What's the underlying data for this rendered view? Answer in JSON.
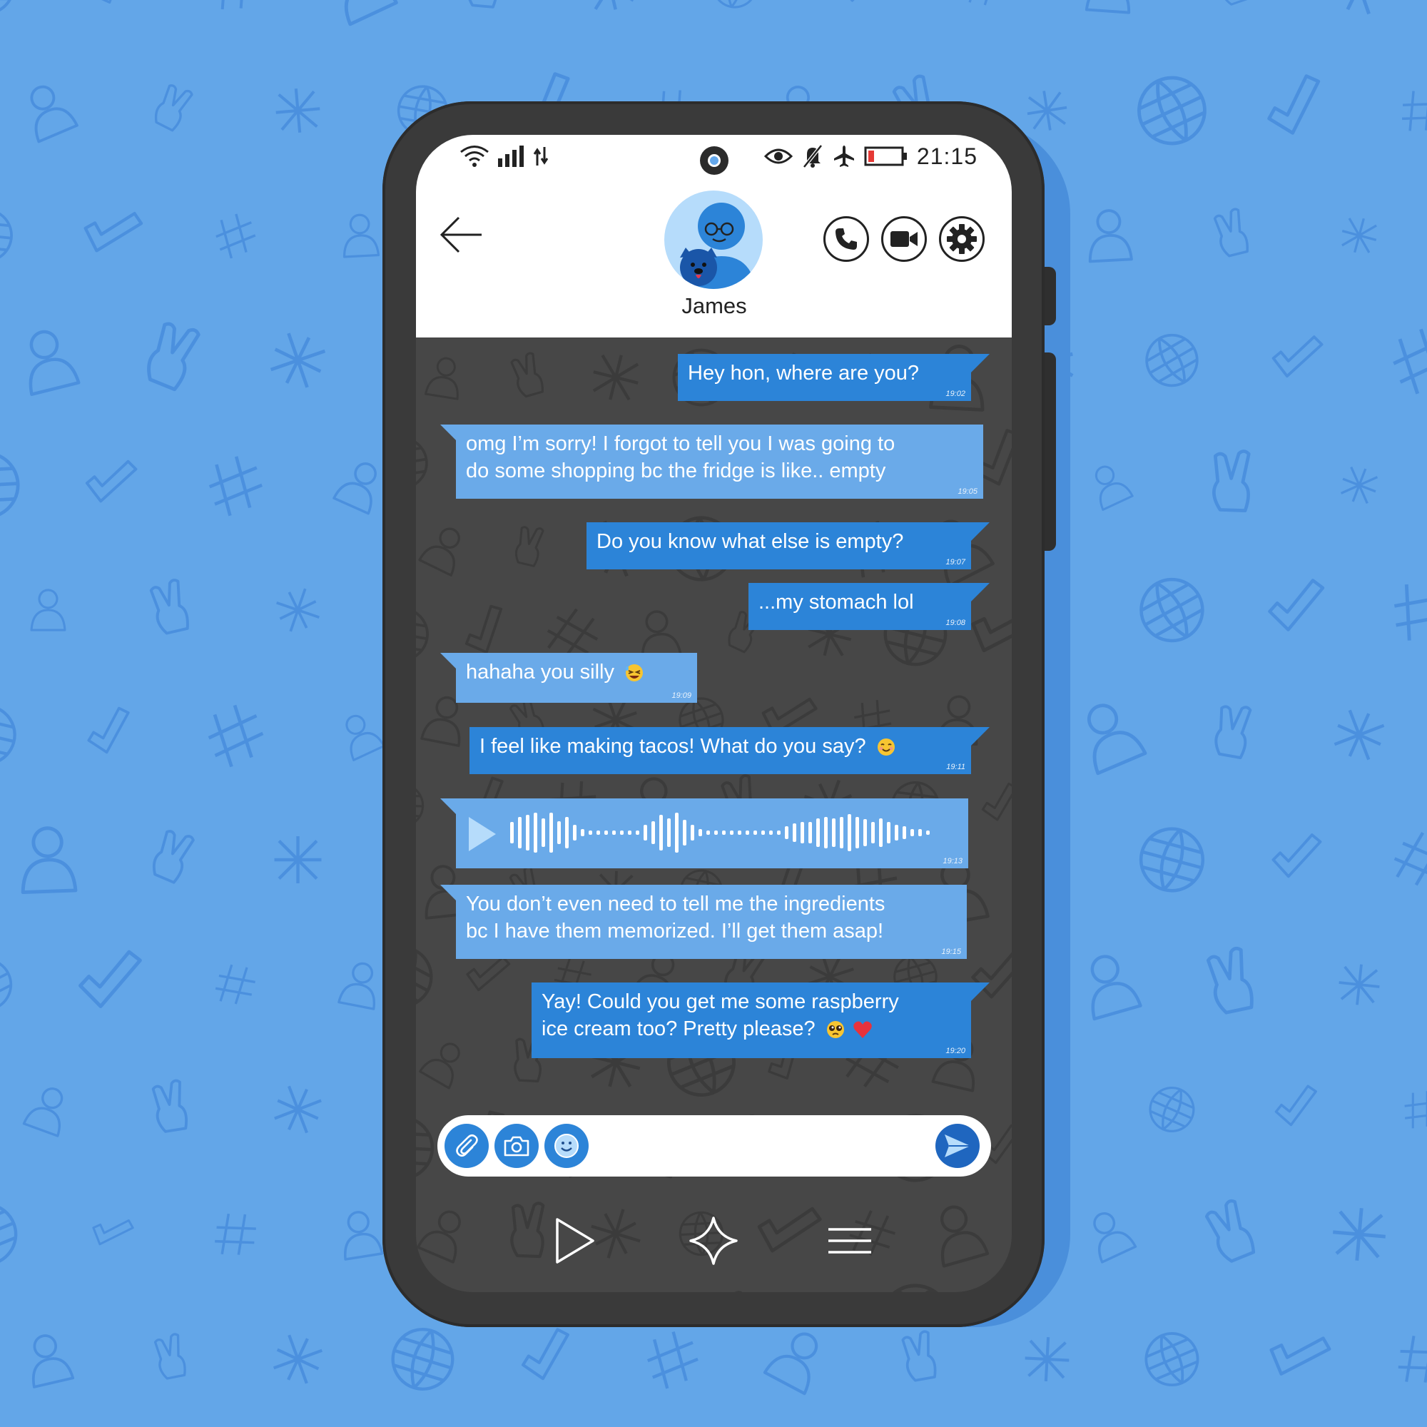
{
  "colors": {
    "background": "#63a6e8",
    "outgoing_bubble": "#2c84d8",
    "incoming_bubble": "#6aaae9",
    "phone_body": "#3a3a3a",
    "chat_background": "#474747",
    "battery_low": "#e53935"
  },
  "status_bar": {
    "time": "21:15",
    "icons": [
      "wifi-icon",
      "signal-icon",
      "data-arrows-icon",
      "eye-icon",
      "bell-muted-icon",
      "airplane-icon",
      "battery-low-icon"
    ]
  },
  "header": {
    "contact_name": "James",
    "icons": [
      "back-arrow-icon",
      "phone-icon",
      "video-camera-icon",
      "gear-icon"
    ]
  },
  "messages": [
    {
      "direction": "out",
      "lines": [
        "Hey hon, where are you?"
      ],
      "time": "19:02"
    },
    {
      "direction": "in",
      "lines": [
        "omg I’m sorry! I forgot to tell you I was going to",
        "do some shopping bc the fridge is like.. empty"
      ],
      "time": "19:05"
    },
    {
      "direction": "out",
      "lines": [
        "Do you know what else is empty?"
      ],
      "time": "19:07"
    },
    {
      "direction": "out",
      "lines": [
        "...my stomach lol"
      ],
      "time": "19:08"
    },
    {
      "direction": "in",
      "lines": [
        "hahaha you silly"
      ],
      "emoji": [
        "laughing-emoji"
      ],
      "time": "19:09"
    },
    {
      "direction": "out",
      "lines": [
        "I feel like making tacos! What do you say?"
      ],
      "emoji": [
        "smiling-emoji"
      ],
      "time": "19:11"
    },
    {
      "direction": "in",
      "type": "voice",
      "time": "19:13"
    },
    {
      "direction": "in",
      "lines": [
        "You don’t even need to tell me the ingredients",
        "bc I have them memorized. I’ll get them asap!"
      ],
      "time": "19:15"
    },
    {
      "direction": "out",
      "lines": [
        "Yay! Could you get me some raspberry",
        "ice cream too? Pretty please?"
      ],
      "emoji": [
        "pleading-emoji",
        "red-heart-emoji"
      ],
      "time": "19:20"
    }
  ],
  "input_bar": {
    "value": "",
    "icons": [
      "paperclip-icon",
      "camera-icon",
      "smiley-icon",
      "send-icon"
    ]
  },
  "nav_bar": {
    "icons": [
      "play-icon",
      "sparkle-star-icon",
      "menu-icon"
    ]
  }
}
